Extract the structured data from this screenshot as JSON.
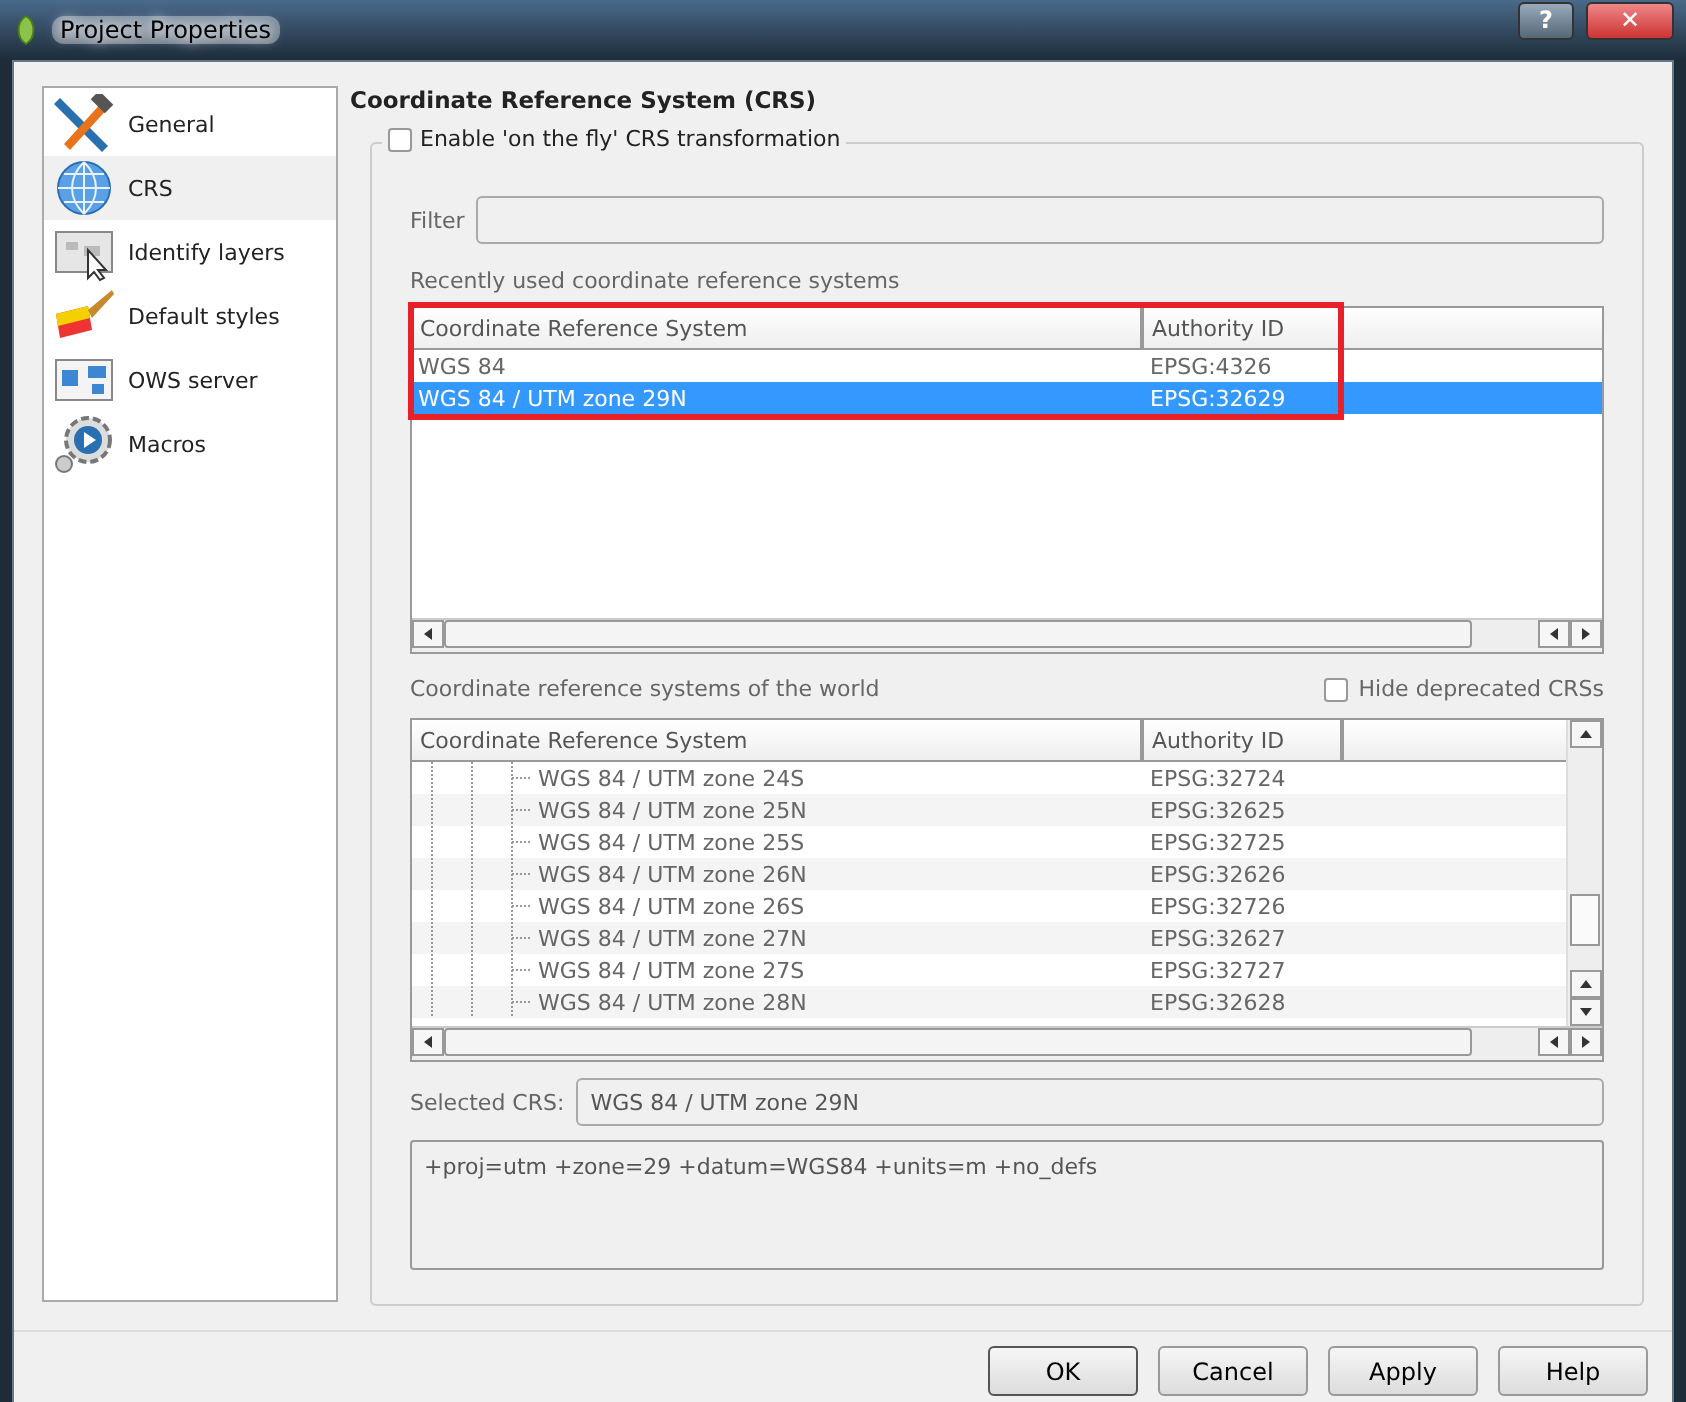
{
  "window": {
    "title": "Project Properties",
    "help_button": "?",
    "close_button": "✕"
  },
  "sidebar": {
    "items": [
      {
        "label": "General",
        "selected": false
      },
      {
        "label": "CRS",
        "selected": true
      },
      {
        "label": "Identify layers",
        "selected": false
      },
      {
        "label": "Default styles",
        "selected": false
      },
      {
        "label": "OWS server",
        "selected": false
      },
      {
        "label": "Macros",
        "selected": false
      }
    ]
  },
  "heading": "Coordinate Reference System (CRS)",
  "group": {
    "checkbox": {
      "label": "Enable 'on the fly' CRS transformation",
      "checked": false
    },
    "filter": {
      "label": "Filter"
    },
    "recent": {
      "label": "Recently used coordinate reference systems",
      "highlighted": true,
      "columns": [
        "Coordinate Reference System",
        "Authority ID"
      ],
      "rows": [
        {
          "name": "WGS 84",
          "authority": "EPSG:4326",
          "selected": false
        },
        {
          "name": "WGS 84 / UTM zone 29N",
          "authority": "EPSG:32629",
          "selected": true
        }
      ]
    },
    "world": {
      "label": "Coordinate reference systems of the world",
      "hide_deprecated": {
        "label": "Hide deprecated CRSs",
        "checked": false
      },
      "columns": [
        "Coordinate Reference System",
        "Authority ID"
      ],
      "rows": [
        {
          "name": "WGS 84 / UTM zone 24S",
          "authority": "EPSG:32724",
          "selected": false
        },
        {
          "name": "WGS 84 / UTM zone 25N",
          "authority": "EPSG:32625",
          "selected": false
        },
        {
          "name": "WGS 84 / UTM zone 25S",
          "authority": "EPSG:32725",
          "selected": false
        },
        {
          "name": "WGS 84 / UTM zone 26N",
          "authority": "EPSG:32626",
          "selected": false
        },
        {
          "name": "WGS 84 / UTM zone 26S",
          "authority": "EPSG:32726",
          "selected": false
        },
        {
          "name": "WGS 84 / UTM zone 27N",
          "authority": "EPSG:32627",
          "selected": false
        },
        {
          "name": "WGS 84 / UTM zone 27S",
          "authority": "EPSG:32727",
          "selected": false
        },
        {
          "name": "WGS 84 / UTM zone 28N",
          "authority": "EPSG:32628",
          "selected": false
        }
      ]
    },
    "selected_crs": {
      "label": "Selected CRS:",
      "value": "WGS 84 / UTM zone 29N"
    },
    "proj_string": "+proj=utm +zone=29 +datum=WGS84 +units=m +no_defs"
  },
  "buttons": [
    {
      "label": "OK",
      "default": true
    },
    {
      "label": "Cancel",
      "default": false
    },
    {
      "label": "Apply",
      "default": false
    },
    {
      "label": "Help",
      "default": false
    }
  ]
}
